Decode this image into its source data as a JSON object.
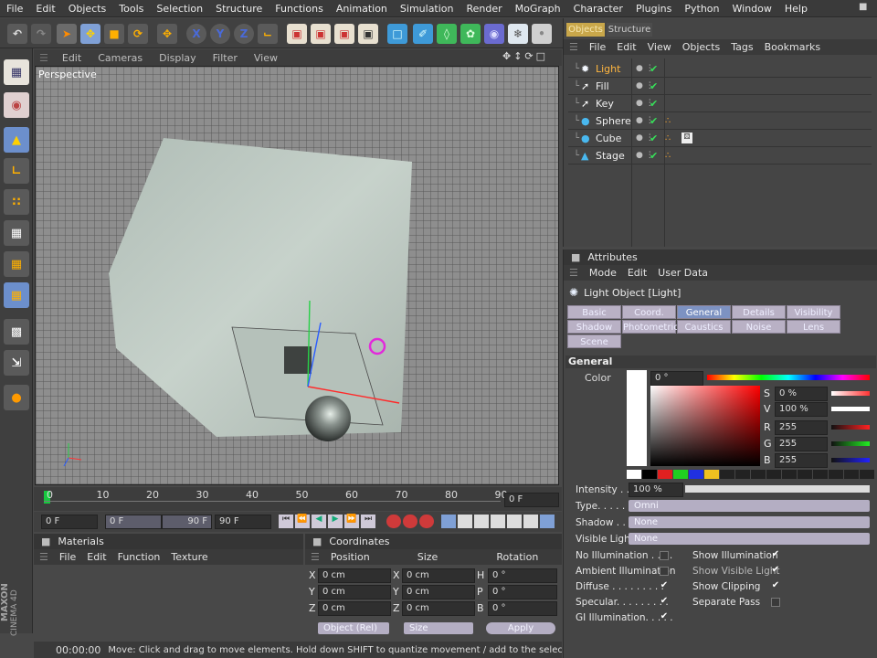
{
  "menubar": [
    "File",
    "Edit",
    "Objects",
    "Tools",
    "Selection",
    "Structure",
    "Functions",
    "Animation",
    "Simulation",
    "Render",
    "MoGraph",
    "Character",
    "Plugins",
    "Python",
    "Window",
    "Help"
  ],
  "viewport": {
    "menu": [
      "Edit",
      "Cameras",
      "Display",
      "Filter",
      "View"
    ],
    "label": "Perspective"
  },
  "object_manager": {
    "tabs": [
      "Objects",
      "Structure"
    ],
    "menu": [
      "File",
      "Edit",
      "View",
      "Objects",
      "Tags",
      "Bookmarks"
    ],
    "objects": [
      {
        "name": "Light",
        "selected": true
      },
      {
        "name": "Fill",
        "selected": false
      },
      {
        "name": "Key",
        "selected": false
      },
      {
        "name": "Sphere",
        "selected": false
      },
      {
        "name": "Cube",
        "selected": false
      },
      {
        "name": "Stage",
        "selected": false
      }
    ]
  },
  "attributes": {
    "title": "Attributes",
    "menu": [
      "Mode",
      "Edit",
      "User Data"
    ],
    "object_title": "Light Object [Light]",
    "tabs_row1": [
      "Basic",
      "Coord.",
      "General",
      "Details",
      "Visibility"
    ],
    "tabs_row2": [
      "Shadow",
      "Photometric",
      "Caustics",
      "Noise",
      "Lens"
    ],
    "tabs_row3": [
      "Scene"
    ],
    "section": "General",
    "color_label": "Color",
    "hue_value": "0 °",
    "hsv": [
      {
        "label": "S",
        "value": "0 %"
      },
      {
        "label": "V",
        "value": "100 %"
      }
    ],
    "rgb": [
      {
        "label": "R",
        "value": "255"
      },
      {
        "label": "G",
        "value": "255"
      },
      {
        "label": "B",
        "value": "255"
      }
    ],
    "intensity_label": "Intensity . . . .",
    "intensity_value": "100 %",
    "type_label": "Type. . . . . . . .",
    "type_value": "Omni",
    "shadow_label": "Shadow . . . . .",
    "shadow_value": "None",
    "visible_light_label": "Visible Light",
    "visible_light_value": "None",
    "left_checks": [
      {
        "label": "No Illumination . . . .",
        "checked": false
      },
      {
        "label": "Ambient Illumination",
        "checked": false
      },
      {
        "label": "Diffuse . . . . . . . . .",
        "checked": true
      },
      {
        "label": "Specular. . . . . . . . .",
        "checked": true
      },
      {
        "label": "GI Illumination. . . . .",
        "checked": true
      }
    ],
    "right_checks": [
      {
        "label": "Show Illumination",
        "checked": true
      },
      {
        "label": "Show Visible Light",
        "checked": true
      },
      {
        "label": "Show Clipping",
        "checked": true
      },
      {
        "label": "Separate Pass",
        "checked": false
      }
    ]
  },
  "timeline": {
    "ticks": [
      "0",
      "10",
      "20",
      "30",
      "40",
      "50",
      "60",
      "70",
      "80",
      "90"
    ],
    "current_frame": "0 F",
    "start_field": "0 F",
    "range_start": "0 F",
    "range_end": "90 F",
    "end_field": "90 F"
  },
  "materials": {
    "title": "Materials",
    "menu": [
      "File",
      "Edit",
      "Function",
      "Texture"
    ]
  },
  "coordinates": {
    "title": "Coordinates",
    "headers": [
      "Position",
      "Size",
      "Rotation"
    ],
    "rows": [
      {
        "axis": "X",
        "pos": "0 cm",
        "size_axis": "X",
        "size": "0 cm",
        "rot_axis": "H",
        "rot": "0 °"
      },
      {
        "axis": "Y",
        "pos": "0 cm",
        "size_axis": "Y",
        "size": "0 cm",
        "rot_axis": "P",
        "rot": "0 °"
      },
      {
        "axis": "Z",
        "pos": "0 cm",
        "size_axis": "Z",
        "size": "0 cm",
        "rot_axis": "B",
        "rot": "0 °"
      }
    ],
    "mode_dropdown": "Object (Rel)",
    "size_dropdown": "Size",
    "apply_button": "Apply"
  },
  "statusbar": {
    "time": "00:00:00",
    "message": "Move: Click and drag to move elements. Hold down SHIFT to quantize movement / add to the selection in point m"
  },
  "branding": [
    "MAXON",
    "CINEMA 4D"
  ]
}
